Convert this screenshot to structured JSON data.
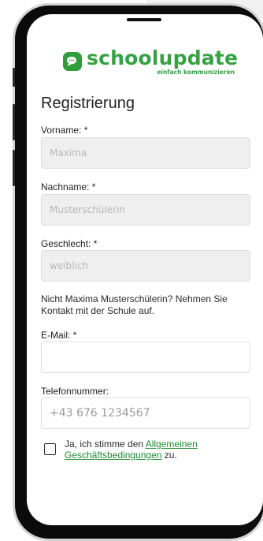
{
  "brand": {
    "name": "schoolupdate",
    "tagline": "einfach kommunizieren",
    "color": "#34a143"
  },
  "form": {
    "title": "Registrierung",
    "first_name": {
      "label": "Vorname: *",
      "value": "Maxima"
    },
    "last_name": {
      "label": "Nachname: *",
      "value": "Musterschülerin"
    },
    "gender": {
      "label": "Geschlecht: *",
      "value": "weiblich"
    },
    "notice": "Nicht Maxima Musterschülerin? Nehmen Sie Kontakt mit der Schule auf.",
    "email": {
      "label": "E-Mail: *",
      "value": ""
    },
    "phone": {
      "label": "Telefonnummer:",
      "placeholder": "+43 676 1234567"
    },
    "terms": {
      "prefix": "Ja, ich stimme den ",
      "link": "Allgemeinen Geschäftsbedingungen",
      "suffix": " zu.",
      "checked": false
    }
  }
}
